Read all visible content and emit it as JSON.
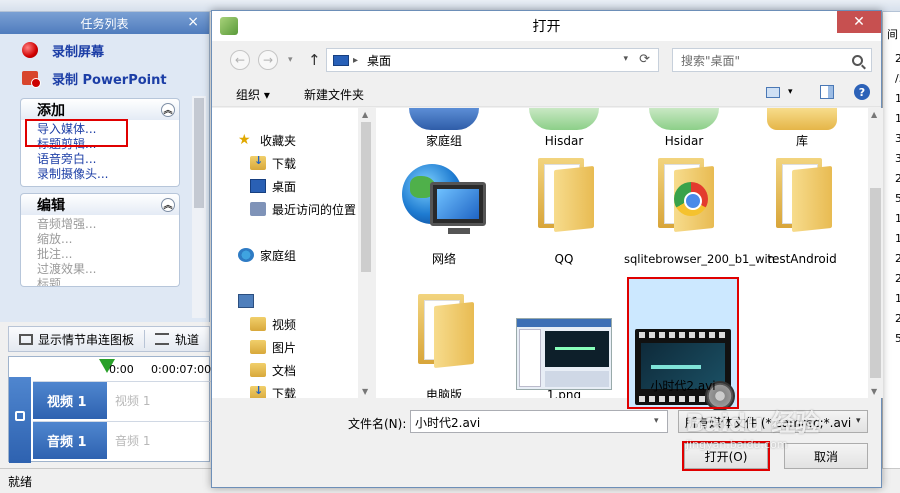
{
  "app": {
    "task_pane_title": "任务列表",
    "record_screen": "录制屏幕",
    "record_ppt": "录制 PowerPoint",
    "add_group": {
      "title": "添加",
      "items": [
        "导入媒体...",
        "标题剪辑...",
        "语音旁白...",
        "录制摄像头..."
      ]
    },
    "edit_group": {
      "title": "编辑",
      "items": [
        "音频增强...",
        "缩放...",
        "批注...",
        "过渡效果...",
        "标题..."
      ]
    },
    "storyboard_button": "显示情节串连图板",
    "track_button": "轨道",
    "timeline": {
      "ruler": [
        "0:00",
        "0:00:07:00"
      ],
      "tracks": [
        {
          "label": "视频 1",
          "placeholder": "视频 1"
        },
        {
          "label": "音频 1",
          "placeholder": "音频 1"
        }
      ]
    },
    "status": "就绪",
    "right_strip_header": "间",
    "right_strip_values": [
      "25",
      "/5",
      "1",
      "12",
      "3",
      "30",
      "25",
      "5",
      "1",
      "10",
      "25",
      "25",
      "1",
      "25",
      "5"
    ]
  },
  "dialog": {
    "title": "打开",
    "address": "桌面",
    "search_placeholder": "搜索\"桌面\"",
    "organize": "组织 ▾",
    "new_folder": "新建文件夹",
    "nav_items": [
      {
        "label": "收藏夹",
        "icon": "star-icon"
      },
      {
        "label": "下载",
        "icon": "download-folder-icon"
      },
      {
        "label": "桌面",
        "icon": "desktop-icon"
      },
      {
        "label": "最近访问的位置",
        "icon": "recent-places-icon"
      },
      {
        "label": "家庭组",
        "icon": "homegroup-icon"
      },
      {
        "label": "",
        "icon": "computer-icon"
      },
      {
        "label": "视频",
        "icon": "videos-folder-icon"
      },
      {
        "label": "图片",
        "icon": "pictures-folder-icon"
      },
      {
        "label": "文档",
        "icon": "documents-folder-icon"
      },
      {
        "label": "下载",
        "icon": "download-folder-icon"
      }
    ],
    "files": [
      {
        "label": "家庭组",
        "icon": "homegroup-icon"
      },
      {
        "label": "Hisdar",
        "icon": "folder-icon"
      },
      {
        "label": "Hsidar",
        "icon": "folder-icon"
      },
      {
        "label": "库",
        "icon": "library-icon"
      },
      {
        "label": "网络",
        "icon": "network-icon"
      },
      {
        "label": "QQ",
        "icon": "folder-icon"
      },
      {
        "label": "sqlitebrowser_200_b1_win",
        "icon": "folder-icon"
      },
      {
        "label": "testAndroid",
        "icon": "folder-icon"
      },
      {
        "label": "电脑版",
        "icon": "folder-icon"
      },
      {
        "label": "1.png",
        "icon": "image-thumbnail-icon"
      },
      {
        "label": "小时代2.avi",
        "icon": "video-file-icon"
      }
    ],
    "file_name_label": "文件名(N):",
    "file_name_value": "小时代2.avi",
    "file_type": "所有媒体文件 (*.camrec;*.avi",
    "open_button": "打开(O)",
    "cancel_button": "取消"
  },
  "watermark": {
    "text": "Baidu 经验",
    "sub": "jingyan.baidu.com"
  }
}
